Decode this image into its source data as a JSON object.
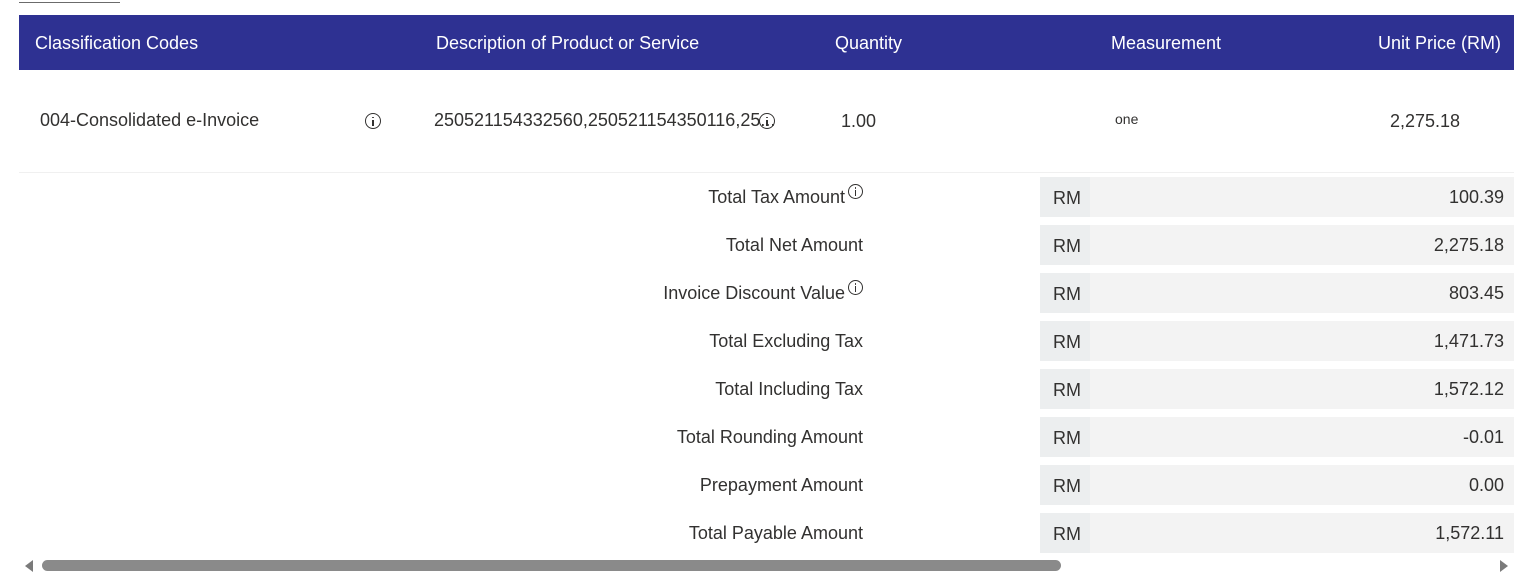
{
  "table": {
    "headers": {
      "classification": "Classification Codes",
      "description": "Description of Product or Service",
      "quantity": "Quantity",
      "measurement": "Measurement",
      "unit_price": "Unit Price (RM)"
    },
    "row": {
      "classification": "004-Consolidated e-Invoice",
      "description": "250521154332560,250521154350116,25...",
      "quantity": "1.00",
      "measurement": "one",
      "unit_price": "2,275.18"
    }
  },
  "summary": [
    {
      "label": "Total Tax Amount",
      "currency": "RM",
      "value": "100.39",
      "has_info": true
    },
    {
      "label": "Total Net Amount",
      "currency": "RM",
      "value": "2,275.18",
      "has_info": false
    },
    {
      "label": "Invoice Discount Value",
      "currency": "RM",
      "value": "803.45",
      "has_info": true
    },
    {
      "label": "Total Excluding Tax",
      "currency": "RM",
      "value": "1,471.73",
      "has_info": false
    },
    {
      "label": "Total Including Tax",
      "currency": "RM",
      "value": "1,572.12",
      "has_info": false
    },
    {
      "label": "Total Rounding Amount",
      "currency": "RM",
      "value": "-0.01",
      "has_info": false
    },
    {
      "label": "Prepayment Amount",
      "currency": "RM",
      "value": "0.00",
      "has_info": false
    },
    {
      "label": "Total Payable Amount",
      "currency": "RM",
      "value": "1,572.11",
      "has_info": false
    }
  ],
  "colors": {
    "header_bg": "#2e3192",
    "header_text": "#ffffff",
    "field_bg": "#f3f3f3"
  },
  "icons": {
    "info": "info-circle-icon",
    "scroll_left": "scroll-left-arrow-icon",
    "scroll_right": "scroll-right-arrow-icon"
  }
}
